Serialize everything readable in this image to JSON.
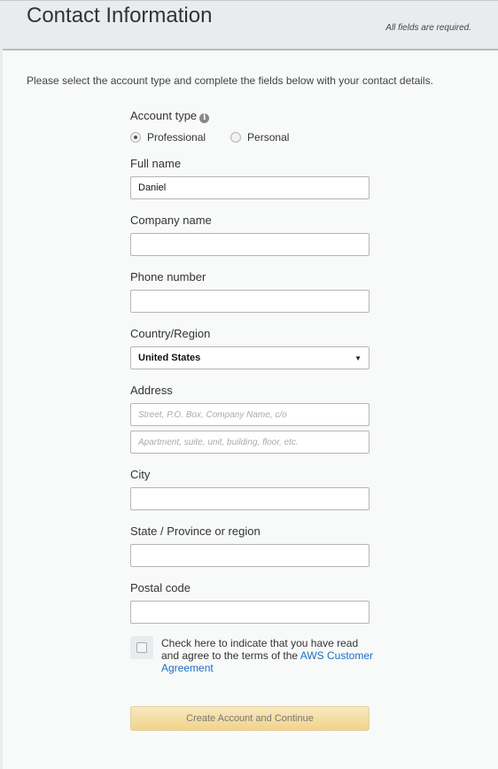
{
  "header": {
    "title": "Contact Information",
    "required_note": "All fields are required."
  },
  "intro": "Please select the account type and complete the fields below with your contact details.",
  "account_type": {
    "label": "Account type",
    "info_icon": "i",
    "options": [
      {
        "label": "Professional",
        "selected": true
      },
      {
        "label": "Personal",
        "selected": false
      }
    ]
  },
  "fields": {
    "full_name": {
      "label": "Full name",
      "value": "Daniel"
    },
    "company_name": {
      "label": "Company name",
      "value": ""
    },
    "phone_number": {
      "label": "Phone number",
      "value": ""
    },
    "country": {
      "label": "Country/Region",
      "value": "United States",
      "caret": "▼"
    },
    "address": {
      "label": "Address",
      "line1_placeholder": "Street, P.O. Box, Company Name, c/o",
      "line2_placeholder": "Apartment, suite, unit, building, floor, etc."
    },
    "city": {
      "label": "City",
      "value": ""
    },
    "state": {
      "label": "State / Province or region",
      "value": ""
    },
    "postal_code": {
      "label": "Postal code",
      "value": ""
    }
  },
  "agreement": {
    "text": "Check here to indicate that you have read and agree to the terms of the ",
    "link": "AWS Customer Agreement",
    "checked": false
  },
  "submit_label": "Create Account and Continue",
  "colors": {
    "link": "#1a6fc2",
    "button_top": "#f8e8bf",
    "button_bottom": "#f1d48a"
  }
}
